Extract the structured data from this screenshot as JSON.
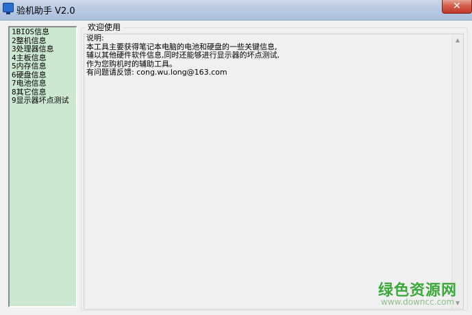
{
  "window": {
    "title": "验机助手 V2.0",
    "close_label": "✕",
    "icon": "monitor-icon"
  },
  "sidebar": {
    "items": [
      {
        "label": "1BIOS信息"
      },
      {
        "label": "2整机信息"
      },
      {
        "label": "3处理器信息"
      },
      {
        "label": "4主板信息"
      },
      {
        "label": "5内存信息"
      },
      {
        "label": "6硬盘信息"
      },
      {
        "label": "7电池信息"
      },
      {
        "label": "8其它信息"
      },
      {
        "label": "9显示器坏点测试"
      }
    ],
    "background": "#cde8d0"
  },
  "main": {
    "group_title": "欢迎使用",
    "lines": [
      "说明:",
      "本工具主要获得笔记本电脑的电池和硬盘的一些关键信息,",
      "辅以其他硬件软件信息,同时还能够进行显示器的坏点测试,",
      "作为您购机时的辅助工具。",
      "有问题请反馈: cong.wu.long@163.com"
    ]
  },
  "watermark": {
    "logo": "绿色资源网",
    "url": "www.downcc.com"
  }
}
